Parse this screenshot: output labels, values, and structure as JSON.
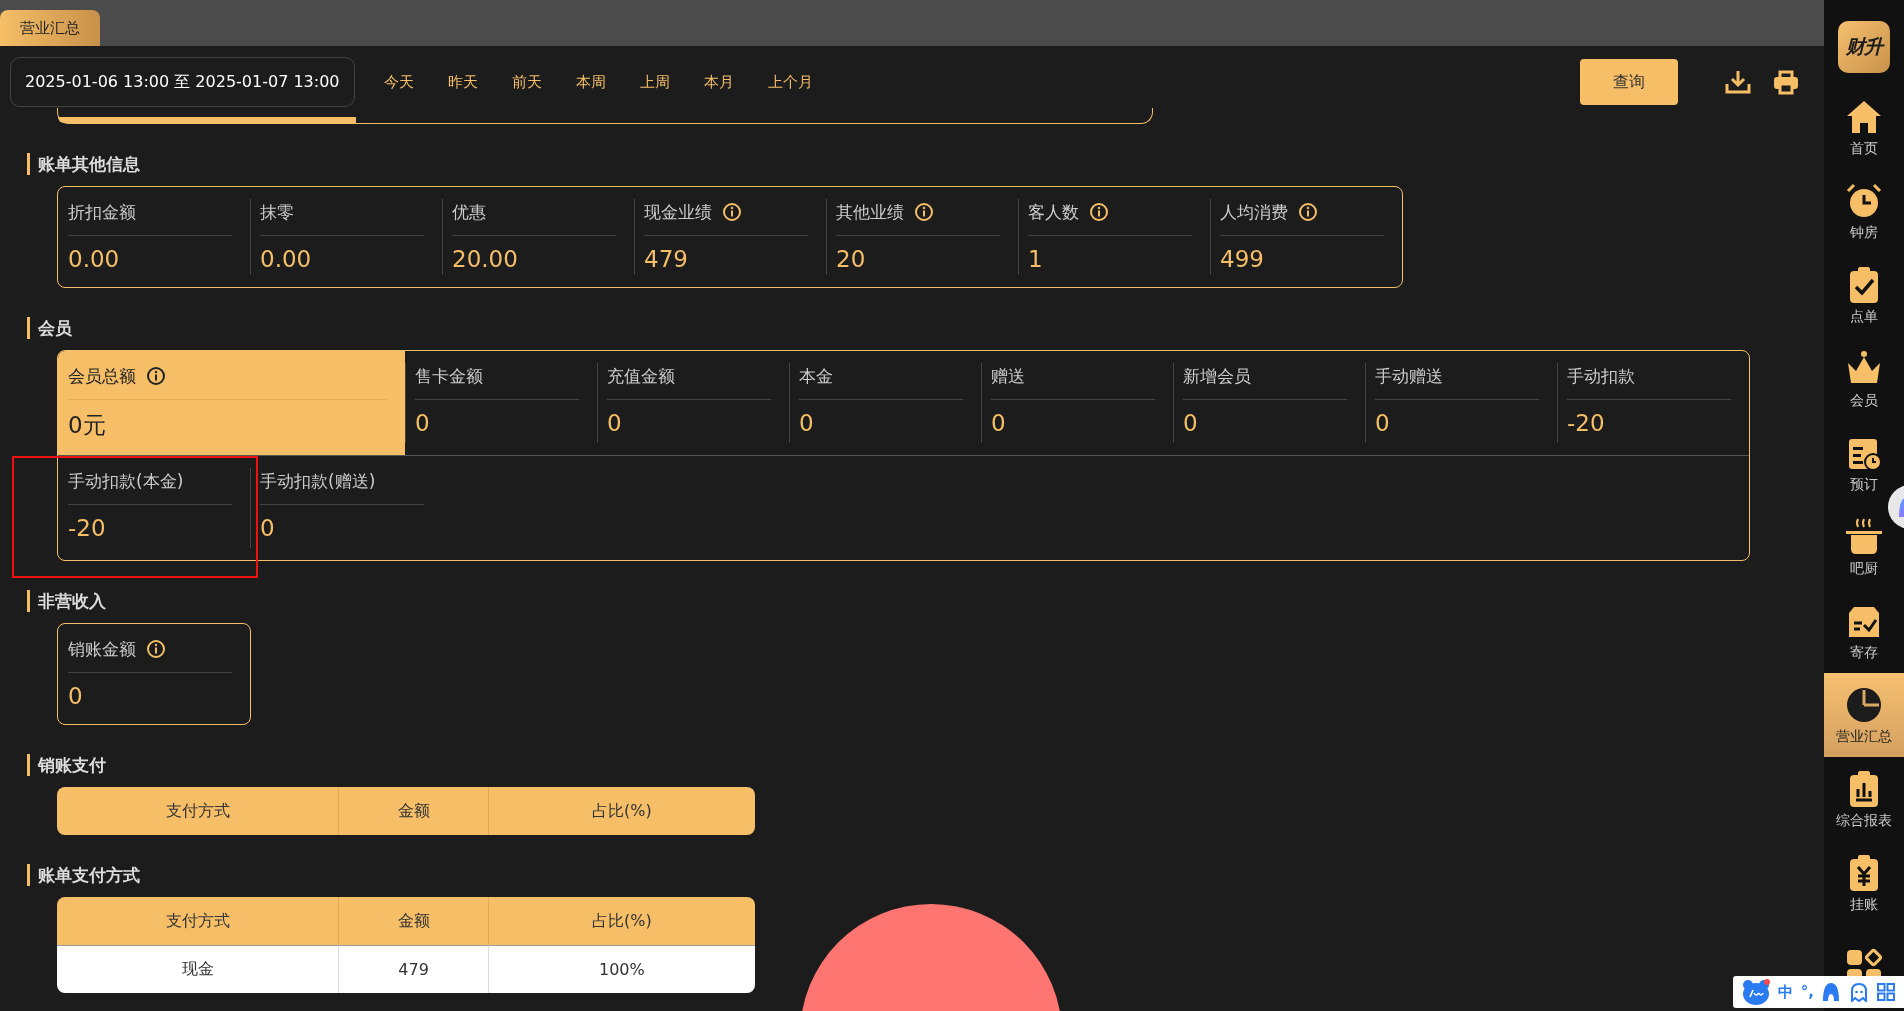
{
  "tabs": [
    {
      "label": "营业汇总",
      "selected": true
    }
  ],
  "toolbar": {
    "date_range": "2025-01-06 13:00 至 2025-01-07 13:00",
    "quick_ranges": [
      "今天",
      "昨天",
      "前天",
      "本周",
      "上周",
      "本月",
      "上个月"
    ],
    "query_button": "查询"
  },
  "sections": [
    {
      "title": "账单其他信息",
      "kind": "stats",
      "rows": [
        [
          {
            "label": "折扣金额",
            "info": false,
            "value": "0.00",
            "selected": false
          },
          {
            "label": "抹零",
            "info": false,
            "value": "0.00",
            "selected": false
          },
          {
            "label": "优惠",
            "info": false,
            "value": "20.00",
            "selected": false
          },
          {
            "label": "现金业绩",
            "info": true,
            "value": "479",
            "selected": false
          },
          {
            "label": "其他业绩",
            "info": true,
            "value": "20",
            "selected": false
          },
          {
            "label": "客人数",
            "info": true,
            "value": "1",
            "selected": false
          },
          {
            "label": "人均消费",
            "info": true,
            "value": "499",
            "selected": false
          }
        ]
      ]
    },
    {
      "title": "会员",
      "kind": "grid",
      "rows": [
        [
          {
            "label": "会员总额",
            "info": true,
            "value": "0元",
            "selected": true
          },
          {
            "label": "售卡金额",
            "info": false,
            "value": "0",
            "selected": false
          },
          {
            "label": "充值金额",
            "info": false,
            "value": "0",
            "selected": false
          },
          {
            "label": "本金",
            "info": false,
            "value": "0",
            "selected": false
          },
          {
            "label": "赠送",
            "info": false,
            "value": "0",
            "selected": false
          },
          {
            "label": "新增会员",
            "info": false,
            "value": "0",
            "selected": false
          },
          {
            "label": "手动赠送",
            "info": false,
            "value": "0",
            "selected": false
          },
          {
            "label": "手动扣款",
            "info": false,
            "value": "-20",
            "selected": false
          }
        ],
        [
          {
            "label": "手动扣款(本金)",
            "info": false,
            "value": "-20",
            "selected": false
          },
          {
            "label": "手动扣款(赠送)",
            "info": false,
            "value": "0",
            "selected": false
          }
        ]
      ]
    },
    {
      "title": "非营收入",
      "kind": "stats",
      "rows": [
        [
          {
            "label": "销账金额",
            "info": true,
            "value": "0",
            "selected": false
          }
        ]
      ]
    },
    {
      "title": "销账支付",
      "kind": "table",
      "columns": [
        "支付方式",
        "金额",
        "占比(%)"
      ]
    },
    {
      "title": "账单支付方式",
      "kind": "table",
      "columns": [
        "支付方式",
        "金额",
        "占比(%)"
      ],
      "rows": [
        [
          "现金",
          "479",
          "100%"
        ]
      ],
      "pie": true
    }
  ],
  "sidebar": {
    "logo": "财升",
    "items": [
      {
        "label": "首页",
        "selected": false
      },
      {
        "label": "钟房",
        "selected": false
      },
      {
        "label": "点单",
        "selected": false
      },
      {
        "label": "会员",
        "selected": false
      },
      {
        "label": "预订",
        "selected": false
      },
      {
        "label": "吧厨",
        "selected": false
      },
      {
        "label": "寄存",
        "selected": false
      },
      {
        "label": "营业汇总",
        "selected": true
      },
      {
        "label": "综合报表",
        "selected": false
      },
      {
        "label": "挂账",
        "selected": false
      },
      {
        "selected": false
      }
    ]
  },
  "ime_toolbar": {
    "labels": [
      "中",
      "°,"
    ]
  }
}
